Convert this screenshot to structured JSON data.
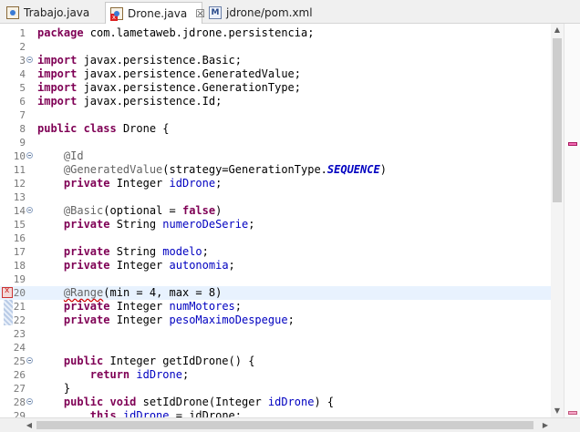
{
  "tabs": [
    {
      "label": "Trabajo.java",
      "icon": "java-file-icon",
      "active": false
    },
    {
      "label": "Drone.java",
      "icon": "java-file-error-icon",
      "active": true,
      "close": "☒"
    },
    {
      "label": "jdrone/pom.xml",
      "icon": "maven-pom-icon",
      "active": false
    }
  ],
  "editor": {
    "current_line": 20,
    "error_line": 20,
    "lines": [
      {
        "n": "1",
        "html": "<span class=\"kw\">package</span> com.lametaweb.jdrone.persistencia;"
      },
      {
        "n": "2",
        "html": ""
      },
      {
        "n": "3",
        "fold": true,
        "html": "<span class=\"kw\">import</span> javax.persistence.Basic;"
      },
      {
        "n": "4",
        "html": "<span class=\"kw\">import</span> javax.persistence.GeneratedValue;"
      },
      {
        "n": "5",
        "html": "<span class=\"kw\">import</span> javax.persistence.GenerationType;"
      },
      {
        "n": "6",
        "html": "<span class=\"kw\">import</span> javax.persistence.Id;"
      },
      {
        "n": "7",
        "html": ""
      },
      {
        "n": "8",
        "html": "<span class=\"kw\">public</span> <span class=\"kw\">class</span> Drone {"
      },
      {
        "n": "9",
        "html": ""
      },
      {
        "n": "10",
        "fold": true,
        "html": "    <span class=\"ann\">@Id</span>"
      },
      {
        "n": "11",
        "html": "    <span class=\"ann\">@GeneratedValue</span>(strategy=GenerationType.<span class=\"cst\">SEQUENCE</span>)"
      },
      {
        "n": "12",
        "html": "    <span class=\"kw\">private</span> Integer <span class=\"fld\">idDrone</span>;"
      },
      {
        "n": "13",
        "html": ""
      },
      {
        "n": "14",
        "fold": true,
        "html": "    <span class=\"ann\">@Basic</span>(optional = <span class=\"kw\">false</span>)"
      },
      {
        "n": "15",
        "html": "    <span class=\"kw\">private</span> String <span class=\"fld\">numeroDeSerie</span>;"
      },
      {
        "n": "16",
        "html": ""
      },
      {
        "n": "17",
        "html": "    <span class=\"kw\">private</span> String <span class=\"fld\">modelo</span>;"
      },
      {
        "n": "18",
        "html": "    <span class=\"kw\">private</span> Integer <span class=\"fld\">autonomia</span>;"
      },
      {
        "n": "19",
        "html": ""
      },
      {
        "n": "20",
        "html": "    <span class=\"ann squiggle\">@Range</span>(min = 4, max = 8)"
      },
      {
        "n": "21",
        "html": "    <span class=\"kw\">private</span> Integer <span class=\"fld\">numMotores</span>;"
      },
      {
        "n": "22",
        "html": "    <span class=\"kw\">private</span> Integer <span class=\"fld\">pesoMaximoDespegue</span>;"
      },
      {
        "n": "23",
        "html": ""
      },
      {
        "n": "24",
        "html": ""
      },
      {
        "n": "25",
        "fold": true,
        "html": "    <span class=\"kw\">public</span> Integer getIdDrone() {"
      },
      {
        "n": "26",
        "html": "        <span class=\"kw\">return</span> <span class=\"fld\">idDrone</span>;"
      },
      {
        "n": "27",
        "html": "    }"
      },
      {
        "n": "28",
        "fold": true,
        "html": "    <span class=\"kw\">public</span> <span class=\"kw\">void</span> setIdDrone(Integer <span class=\"fld\">idDrone</span>) {"
      },
      {
        "n": "29",
        "html": "        <span class=\"kw\">this</span>.<span class=\"fld\">idDrone</span> = idDrone;"
      }
    ]
  },
  "colors": {
    "keyword": "#7f0055",
    "annotation": "#646464",
    "field": "#0000c0",
    "current_line": "#e8f2fe",
    "error": "#d00000"
  },
  "scrollbars": {
    "up_arrow": "▲",
    "down_arrow": "▼",
    "left_arrow": "◀",
    "right_arrow": "▶"
  }
}
